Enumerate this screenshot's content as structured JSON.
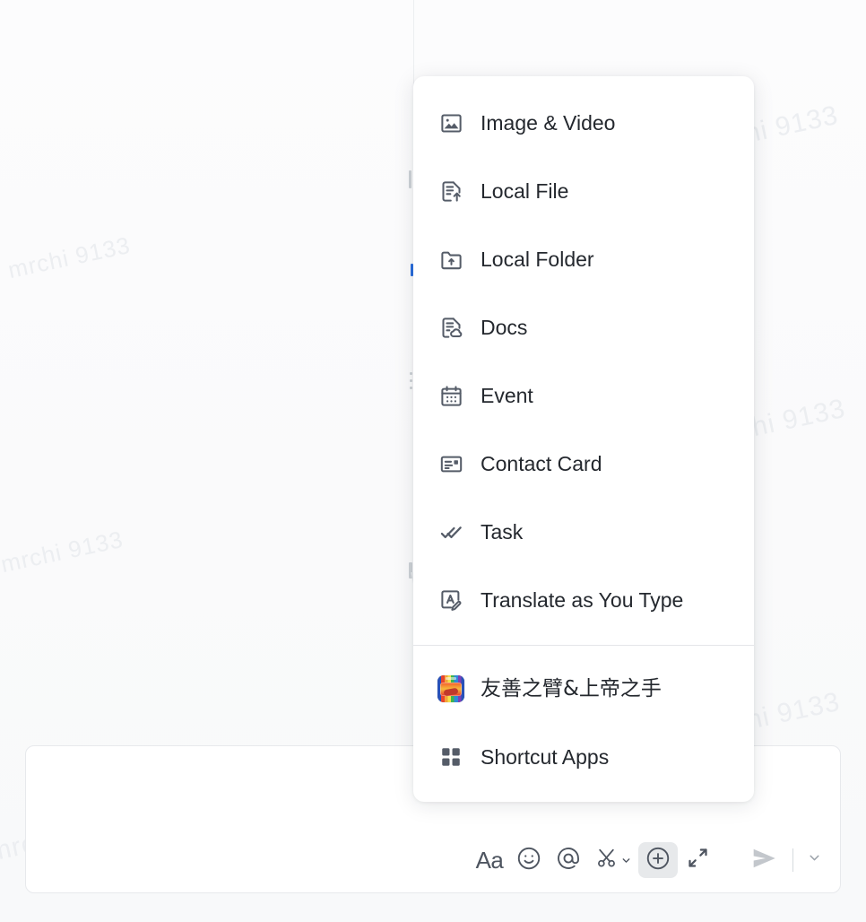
{
  "background": {
    "watermarks": [
      "mrchi 9133",
      "mrchi 9133",
      "mrchi 9133",
      "mrchi 9133",
      "mrchi 9133",
      "mrchi 9133",
      "mrchi 9133",
      "mrchi 9133",
      "mrchi 9133"
    ]
  },
  "composer": {
    "placeholder": "",
    "value": ""
  },
  "toolbar": {
    "font_label": "Aa",
    "items": [
      {
        "name": "font-style-button",
        "icon": "font-icon",
        "label": "Aa"
      },
      {
        "name": "emoji-button",
        "icon": "smiley-icon",
        "label": "Emoji"
      },
      {
        "name": "mention-button",
        "icon": "at-icon",
        "label": "Mention"
      },
      {
        "name": "screenshot-button",
        "icon": "scissors-icon",
        "label": "Screenshot"
      },
      {
        "name": "attachment-button",
        "icon": "plus-circle-icon",
        "label": "More"
      },
      {
        "name": "expand-button",
        "icon": "expand-icon",
        "label": "Expand"
      },
      {
        "name": "send-button",
        "icon": "send-icon",
        "label": "Send"
      },
      {
        "name": "send-options-button",
        "icon": "chevron-down-icon",
        "label": "Send options"
      }
    ]
  },
  "menu": {
    "items": [
      {
        "label": "Image & Video",
        "icon": "image-icon"
      },
      {
        "label": "Local File",
        "icon": "file-upload-icon"
      },
      {
        "label": "Local Folder",
        "icon": "folder-upload-icon"
      },
      {
        "label": "Docs",
        "icon": "cloud-doc-icon"
      },
      {
        "label": "Event",
        "icon": "calendar-icon"
      },
      {
        "label": "Contact Card",
        "icon": "contact-card-icon"
      },
      {
        "label": "Task",
        "icon": "task-check-icon"
      },
      {
        "label": "Translate as You Type",
        "icon": "translate-icon"
      }
    ],
    "apps": [
      {
        "label": "友善之臂&上帝之手",
        "icon": "app-color-icon"
      },
      {
        "label": "Shortcut Apps",
        "icon": "grid-apps-icon"
      }
    ]
  },
  "colors": {
    "icon": "#555c68",
    "text": "#24282e",
    "active_bg": "#e7e9eb",
    "send_disabled": "#c3c7cc"
  }
}
